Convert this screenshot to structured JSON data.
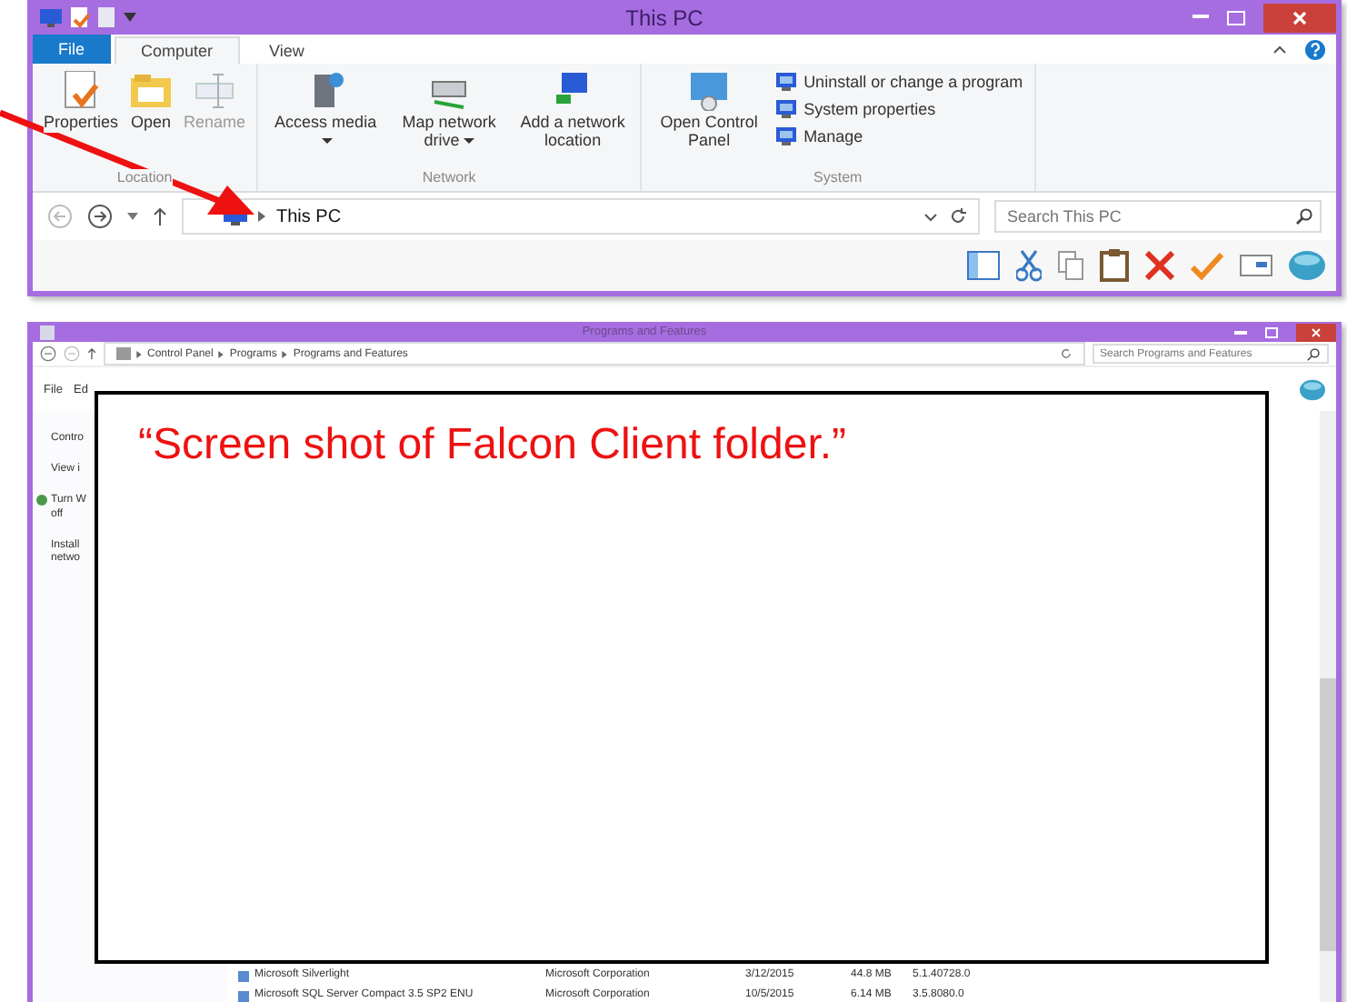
{
  "explorer_window": {
    "title": "This PC",
    "tabs": [
      {
        "label": "File",
        "kind": "file",
        "selected": false
      },
      {
        "label": "Computer",
        "kind": "tab",
        "selected": true
      },
      {
        "label": "View",
        "kind": "tab",
        "selected": false
      }
    ],
    "ribbon_groups": [
      {
        "label": "Location",
        "items": [
          {
            "label": "Properties",
            "kind": "large",
            "disabled": false,
            "has_menu": false
          },
          {
            "label": "Open",
            "kind": "large",
            "disabled": false,
            "has_menu": false
          },
          {
            "label": "Rename",
            "kind": "large",
            "disabled": true,
            "has_menu": false
          }
        ]
      },
      {
        "label": "Network",
        "items": [
          {
            "label": "Access media",
            "kind": "large",
            "disabled": false,
            "has_menu": true
          },
          {
            "label": "Map network drive",
            "kind": "large",
            "disabled": false,
            "has_menu": true
          },
          {
            "label": "Add a network location",
            "kind": "large",
            "disabled": false,
            "has_menu": false
          }
        ]
      },
      {
        "label": "System",
        "items": [
          {
            "label": "Open Control Panel",
            "kind": "large",
            "disabled": false,
            "has_menu": false
          },
          {
            "label": "Uninstall or change a program",
            "kind": "small",
            "disabled": false,
            "has_menu": false
          },
          {
            "label": "System properties",
            "kind": "small",
            "disabled": false,
            "has_menu": false
          },
          {
            "label": "Manage",
            "kind": "small",
            "disabled": false,
            "has_menu": false
          }
        ]
      }
    ],
    "address": {
      "location": "This PC",
      "search_placeholder": "Search This PC"
    }
  },
  "programs_window": {
    "title": "Programs and Features",
    "breadcrumb": [
      "Control Panel",
      "Programs",
      "Programs and Features"
    ],
    "search_placeholder": "Search Programs and Features",
    "menu": [
      "File",
      "Ed"
    ],
    "sidebar": [
      [
        "Contro"
      ],
      [
        "View i"
      ],
      [
        "Turn W",
        "off"
      ],
      [
        "Install",
        "netwo"
      ]
    ],
    "rows": [
      [
        "Microsoft Silverlight",
        "Microsoft Corporation",
        "3/12/2015",
        "44.8 MB",
        "5.1.40728.0"
      ],
      [
        "Microsoft SQL Server Compact 3.5 SP2 ENU",
        "Microsoft Corporation",
        "10/5/2015",
        "6.14 MB",
        "3.5.8080.0"
      ]
    ]
  },
  "overlay_note": {
    "text": "“Screen shot of Falcon Client folder.”"
  }
}
